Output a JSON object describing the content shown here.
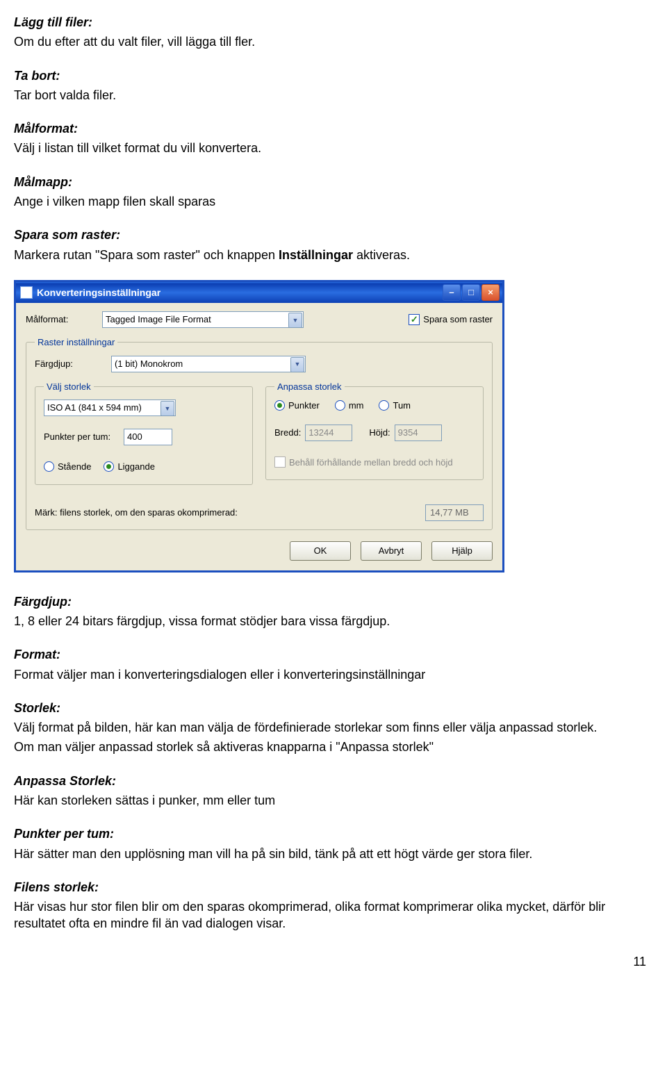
{
  "doc": {
    "lagg_till": {
      "h": "Lägg till filer:",
      "t": "Om du efter att du valt filer, vill lägga till fler."
    },
    "ta_bort": {
      "h": "Ta bort:",
      "t": "Tar bort valda filer."
    },
    "malformat": {
      "h": "Målformat:",
      "t": "Välj i listan till vilket format du vill konvertera."
    },
    "malmapp": {
      "h": "Målmapp:",
      "t": "Ange i vilken mapp filen skall sparas"
    },
    "spara_som_raster": {
      "h": "Spara som raster:",
      "t1": "Markera rutan \"Spara som raster\" och  knappen ",
      "t2": "Inställningar",
      "t3": " aktiveras."
    },
    "fargdjup": {
      "h": "Färgdjup:",
      "t": "1, 8 eller 24 bitars färgdjup, vissa format stödjer bara vissa färgdjup."
    },
    "format": {
      "h": "Format:",
      "t": "Format väljer man i konverteringsdialogen eller i konverteringsinställningar"
    },
    "storlek": {
      "h": "Storlek:",
      "t1": "Välj format på bilden, här kan man välja de fördefinierade storlekar som finns eller välja anpassad storlek.",
      "t2": "Om man väljer anpassad storlek så aktiveras knapparna i \"Anpassa storlek\""
    },
    "anpassa": {
      "h": "Anpassa Storlek:",
      "t": "Här kan storleken sättas i punker, mm eller tum"
    },
    "ppt": {
      "h": "Punkter per tum:",
      "t": "Här sätter man den upplösning man vill ha på sin bild, tänk på att ett högt värde ger stora filer."
    },
    "filstorlek": {
      "h": "Filens storlek:",
      "t": "Här visas hur stor filen blir om den sparas okomprimerad, olika format komprimerar olika mycket, därför blir resultatet ofta en mindre fil än vad dialogen visar."
    },
    "pagenum": "11"
  },
  "dialog": {
    "title": "Konverteringsinställningar",
    "labels": {
      "malformat": "Målformat:",
      "spara_som_raster": "Spara som raster",
      "raster_group": "Raster inställningar",
      "fargdjup": "Färgdjup:",
      "valj_storlek": "Välj storlek",
      "anpassa_storlek": "Anpassa storlek",
      "ppt": "Punkter per tum:",
      "bredd": "Bredd:",
      "hojd": "Höjd:",
      "behall": "Behåll förhållande mellan bredd och höjd",
      "staende": "Stående",
      "liggande": "Liggande",
      "punkter": "Punkter",
      "mm": "mm",
      "tum": "Tum",
      "mark": "Märk: filens storlek, om den sparas okomprimerad:"
    },
    "values": {
      "malformat": "Tagged Image File Format",
      "spara_som_raster_checked": true,
      "fargdjup": "(1 bit) Monokrom",
      "size": "ISO A1 (841 x 594 mm)",
      "ppt": "400",
      "bredd": "13244",
      "hojd": "9354",
      "behall_checked": false,
      "orientation": "liggande",
      "unit": "punkter",
      "filesize": "14,77 MB"
    },
    "buttons": {
      "ok": "OK",
      "cancel": "Avbryt",
      "help": "Hjälp"
    }
  }
}
